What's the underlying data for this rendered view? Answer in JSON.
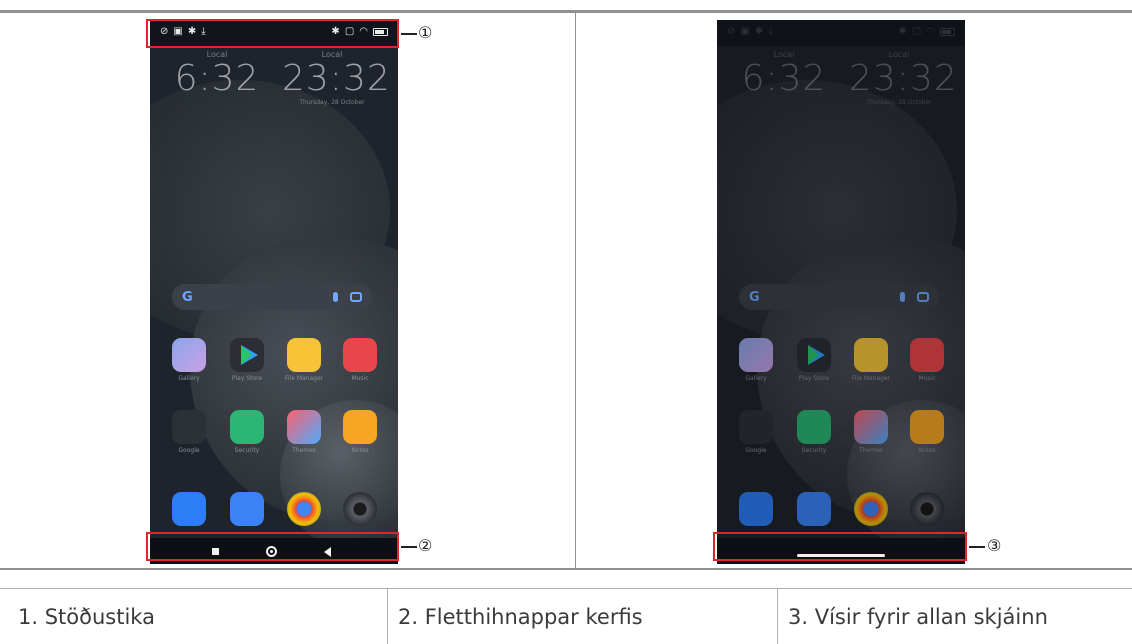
{
  "phones": {
    "left": {
      "clock_left": {
        "city": "Local",
        "time": "6:32",
        "date": ""
      },
      "clock_right": {
        "city": "Local",
        "time": "23:32",
        "date": "Thursday, 28 October"
      },
      "apps": [
        "Gallery",
        "Play Store",
        "File Manager",
        "Music",
        "Google",
        "Security",
        "Themes",
        "Notes"
      ]
    },
    "right": {
      "clock_left": {
        "city": "Local",
        "time": "6:32",
        "date": ""
      },
      "clock_right": {
        "city": "Local",
        "time": "23:32",
        "date": "Thursday, 28 October"
      },
      "apps": [
        "Gallery",
        "Play Store",
        "File Manager",
        "Music",
        "Google",
        "Security",
        "Themes",
        "Notes"
      ]
    }
  },
  "callouts": [
    "①",
    "②",
    "③"
  ],
  "captions": [
    "1. Stöðustika",
    "2. Fletthihnappar kerfis",
    "3. Vísir fyrir allan skjáinn"
  ],
  "colors": {
    "highlight": "#e0262b",
    "rule": "#8f8f8f",
    "caption_text": "#3a3a3a"
  }
}
